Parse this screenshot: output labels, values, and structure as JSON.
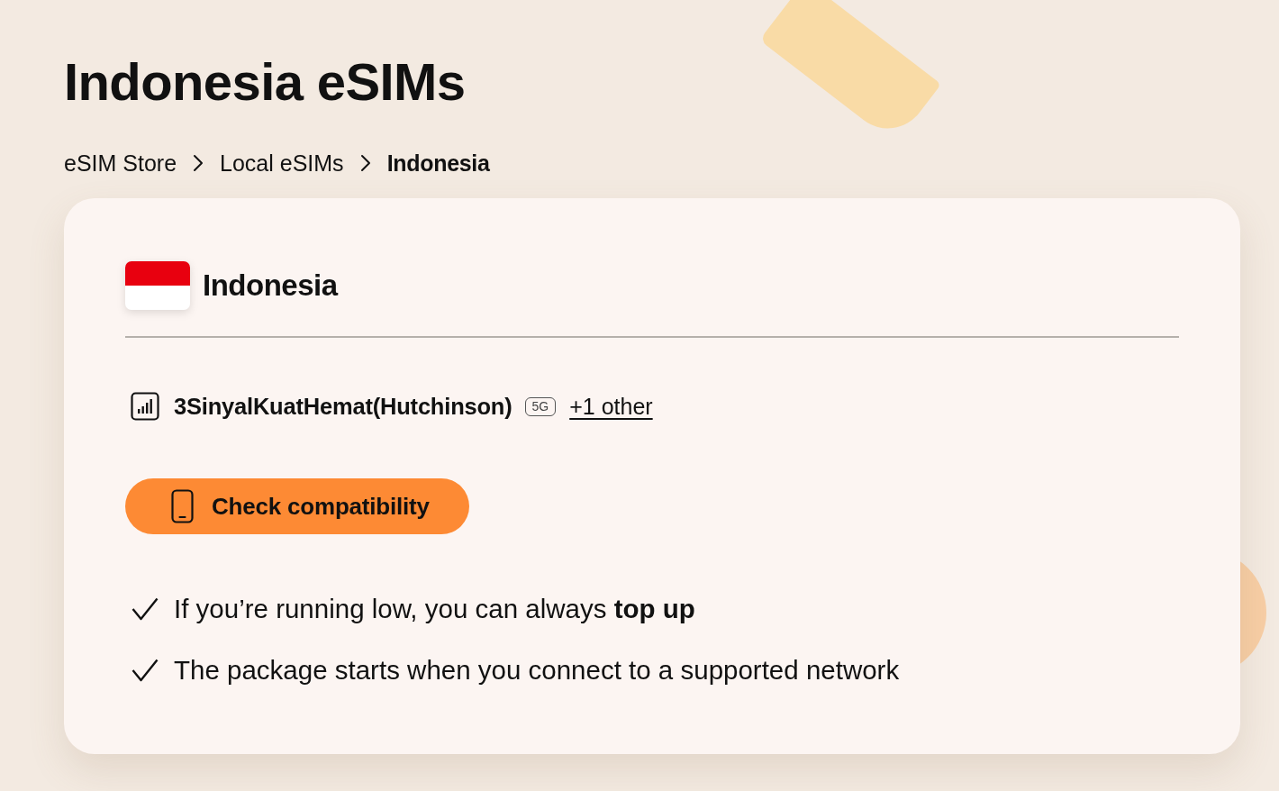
{
  "page": {
    "title": "Indonesia eSIMs"
  },
  "breadcrumb": [
    {
      "label": "eSIM Store",
      "current": false
    },
    {
      "label": "Local eSIMs",
      "current": false
    },
    {
      "label": "Indonesia",
      "current": true
    }
  ],
  "card": {
    "country": "Indonesia",
    "network": {
      "name": "3SinyalKuatHemat(Hutchinson)",
      "badge": "5G",
      "more_link": "+1 other"
    },
    "button": "Check compatibility",
    "features": [
      "If you’re running low, you can always **top up**",
      "The package starts when you connect to a supported network"
    ]
  }
}
